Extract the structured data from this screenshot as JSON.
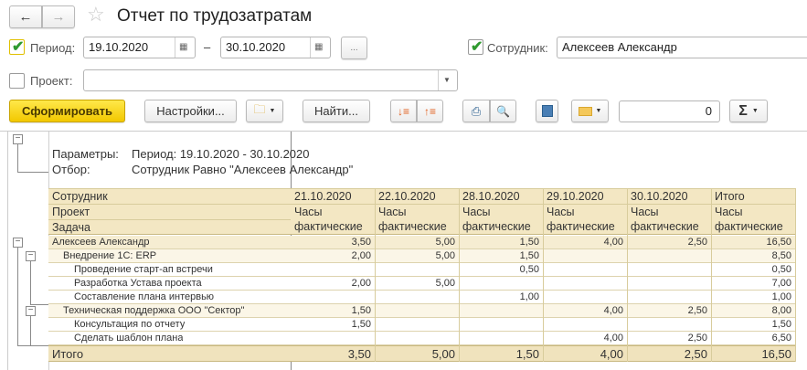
{
  "header": {
    "title": "Отчет по трудозатратам",
    "back_icon": "arrow-left-icon",
    "forward_icon": "arrow-right-icon",
    "favorite_icon": "star-icon"
  },
  "filters": {
    "period": {
      "label": "Период:",
      "checked": true,
      "from": "19.10.2020",
      "to": "30.10.2020",
      "dash": "–",
      "more": "..."
    },
    "employee": {
      "label": "Сотрудник:",
      "checked": true,
      "value": "Алексеев Александр"
    },
    "project": {
      "label": "Проект:",
      "checked": false,
      "value": ""
    }
  },
  "toolbar": {
    "generate": "Сформировать",
    "settings": "Настройки...",
    "find": "Найти...",
    "number_value": "0",
    "sigma": "Σ"
  },
  "report": {
    "params_label": "Параметры:",
    "params_value": "Период: 19.10.2020 - 30.10.2020",
    "filter_label": "Отбор:",
    "filter_value": "Сотрудник Равно \"Алексеев Александр\"",
    "group_headers": [
      "Сотрудник",
      "Проект",
      "Задача"
    ],
    "columns": [
      "21.10.2020",
      "22.10.2020",
      "28.10.2020",
      "29.10.2020",
      "30.10.2020",
      "Итого"
    ],
    "col_sub1": "Часы",
    "col_sub2": "фактические",
    "rows": [
      {
        "level": 0,
        "name": "Алексеев Александр",
        "values": [
          "3,50",
          "5,00",
          "1,50",
          "4,00",
          "2,50",
          "16,50"
        ]
      },
      {
        "level": 1,
        "name": "Внедрение 1С: ERP",
        "values": [
          "2,00",
          "5,00",
          "1,50",
          "",
          "",
          "8,50"
        ]
      },
      {
        "level": 2,
        "name": "Проведение старт-ап встречи",
        "values": [
          "",
          "",
          "0,50",
          "",
          "",
          "0,50"
        ]
      },
      {
        "level": 2,
        "name": "Разработка Устава проекта",
        "values": [
          "2,00",
          "5,00",
          "",
          "",
          "",
          "7,00"
        ]
      },
      {
        "level": 2,
        "name": "Составление плана интервью",
        "values": [
          "",
          "",
          "1,00",
          "",
          "",
          "1,00"
        ]
      },
      {
        "level": 1,
        "name": "Техническая поддержка ООО \"Сектор\"",
        "values": [
          "1,50",
          "",
          "",
          "4,00",
          "2,50",
          "8,00"
        ]
      },
      {
        "level": 2,
        "name": "Консультация по отчету",
        "values": [
          "1,50",
          "",
          "",
          "",
          "",
          "1,50"
        ]
      },
      {
        "level": 2,
        "name": "Сделать шаблон плана",
        "values": [
          "",
          "",
          "",
          "4,00",
          "2,50",
          "6,50"
        ]
      }
    ],
    "total": {
      "name": "Итого",
      "values": [
        "3,50",
        "5,00",
        "1,50",
        "4,00",
        "2,50",
        "16,50"
      ]
    }
  }
}
